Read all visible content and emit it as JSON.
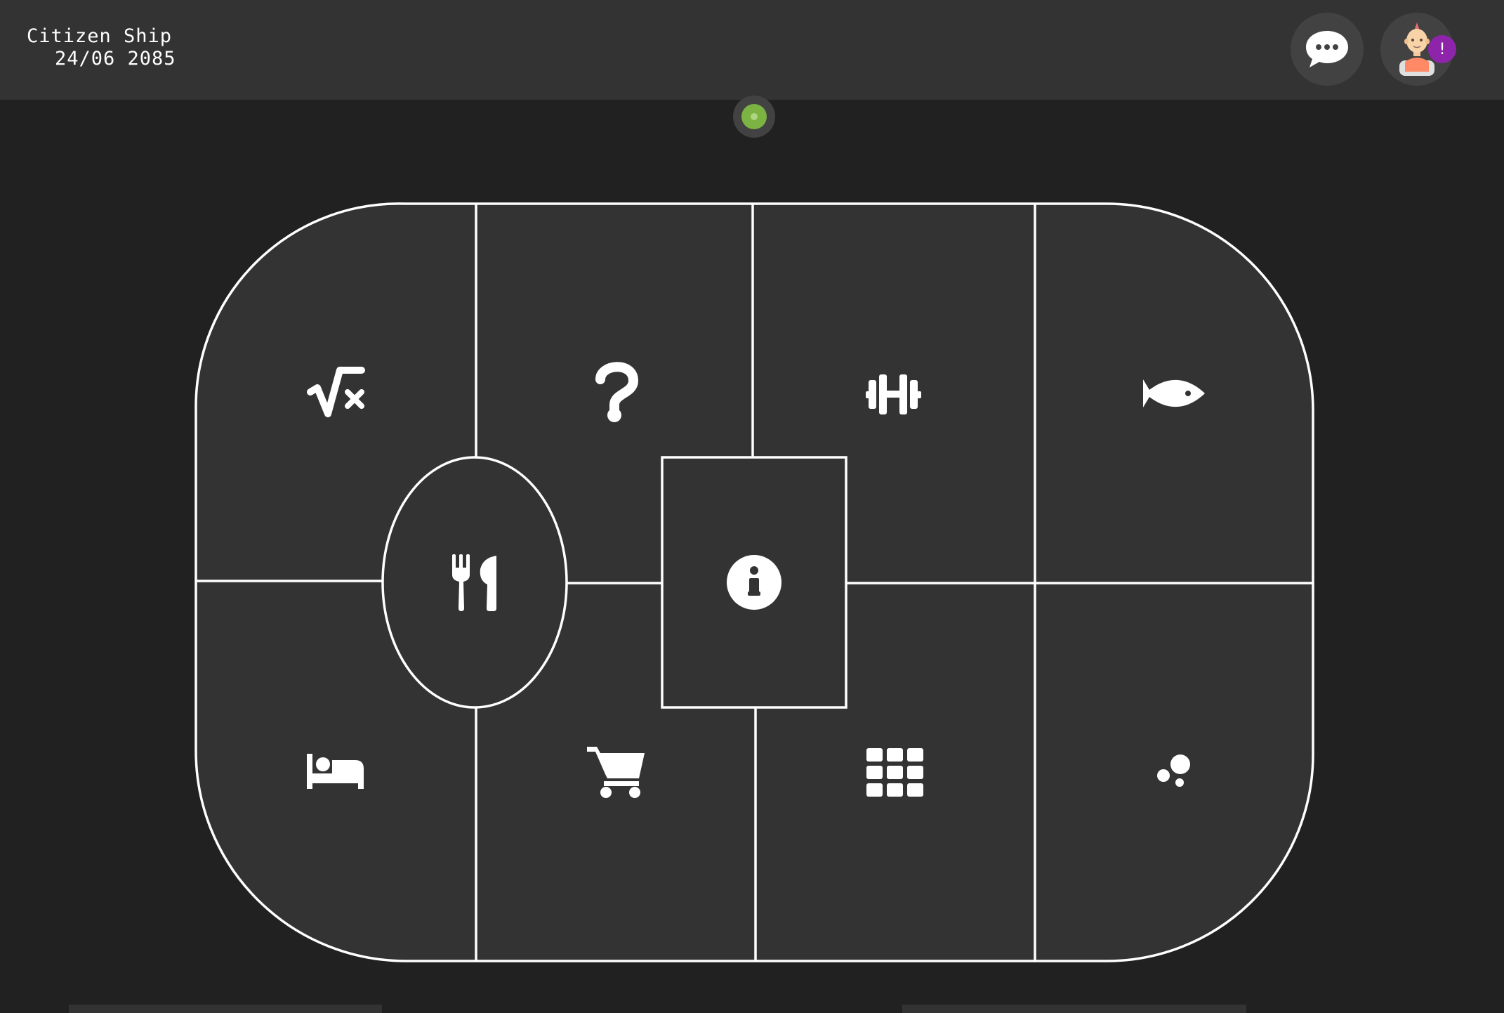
{
  "header": {
    "title": "Citizen Ship",
    "date": "24/06 2085"
  },
  "actions": {
    "chat_icon": "chat-bubble-dots-icon",
    "profile_icon": "citizen-avatar-icon",
    "notification_badge": "!"
  },
  "status": {
    "state_color": "#7cb342"
  },
  "ship_map": {
    "sections": [
      {
        "id": "math",
        "icon": "square-root-icon"
      },
      {
        "id": "help",
        "icon": "question-mark-icon"
      },
      {
        "id": "gym",
        "icon": "dumbbell-icon"
      },
      {
        "id": "aquarium",
        "icon": "fish-icon"
      },
      {
        "id": "dining",
        "icon": "fork-knife-icon"
      },
      {
        "id": "info",
        "icon": "info-circle-icon"
      },
      {
        "id": "sleep",
        "icon": "bed-icon"
      },
      {
        "id": "shop",
        "icon": "shopping-cart-icon"
      },
      {
        "id": "apps",
        "icon": "grid-icon"
      },
      {
        "id": "lab",
        "icon": "bubbles-icon"
      }
    ]
  },
  "colors": {
    "background": "#212121",
    "panel": "#333333",
    "outline": "#ffffff",
    "badge": "#8e24aa"
  }
}
